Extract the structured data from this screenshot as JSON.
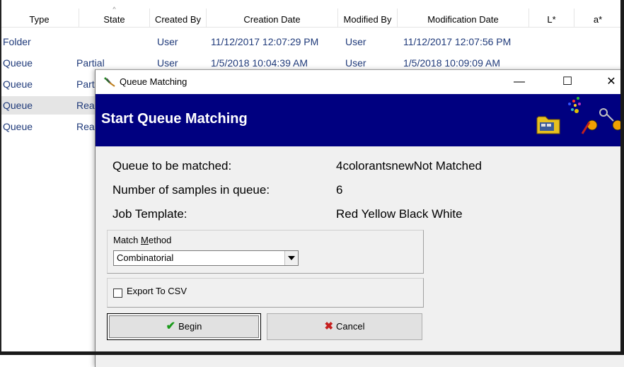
{
  "list": {
    "columns": [
      "Type",
      "State",
      "Created By",
      "Creation Date",
      "Modified By",
      "Modification Date",
      "L*",
      "a*"
    ],
    "rows": [
      {
        "type": "Folder",
        "state": "",
        "created_by": "User",
        "creation_date": "11/12/2017 12:07:29 PM",
        "modified_by": "User",
        "modification_date": "11/12/2017 12:07:56 PM"
      },
      {
        "type": "Queue",
        "state": "Partial",
        "created_by": "User",
        "creation_date": "1/5/2018 10:04:39 AM",
        "modified_by": "User",
        "modification_date": "1/5/2018 10:09:09 AM"
      },
      {
        "type": "Queue",
        "state": "Part",
        "created_by": "",
        "creation_date": "",
        "modified_by": "",
        "modification_date": ""
      },
      {
        "type": "Queue",
        "state": "Rea",
        "created_by": "",
        "creation_date": "",
        "modified_by": "",
        "modification_date": ""
      },
      {
        "type": "Queue",
        "state": "Rea",
        "created_by": "",
        "creation_date": "",
        "modified_by": "",
        "modification_date": ""
      }
    ]
  },
  "dialog": {
    "title": "Queue Matching",
    "banner_title": "Start Queue Matching",
    "info": [
      {
        "label": "Queue to be matched:",
        "value": "4colorantsnewNot Matched"
      },
      {
        "label": "Number of samples in queue:",
        "value": "6"
      },
      {
        "label": "Job Template:",
        "value": "Red Yellow Black White"
      }
    ],
    "match_method_label_pre": "Match ",
    "match_method_label_underline": "M",
    "match_method_label_post": "ethod",
    "match_method_value": "Combinatorial",
    "export_label": "Export To CSV",
    "export_checked": false,
    "begin_label": "Begin",
    "cancel_label": "Cancel",
    "window_controls": {
      "minimize": "—",
      "maximize": "☐",
      "close": "✕"
    }
  },
  "colors": {
    "banner": "#000080",
    "link_text": "#1f3a7a",
    "selected_row": "#e5e5e5"
  }
}
